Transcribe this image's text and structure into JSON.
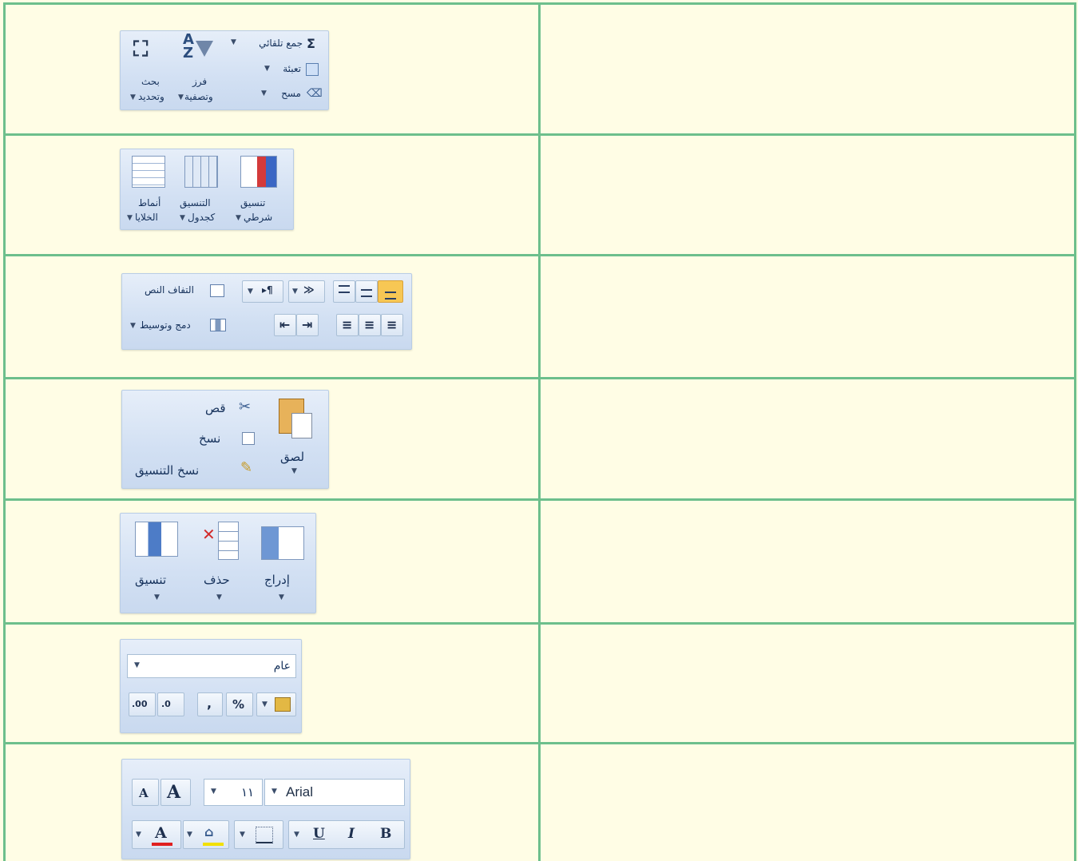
{
  "editing_group": {
    "autosum": "جمع تلقائي",
    "fill": "تعبئة",
    "clear": "مسح",
    "sort_filter": [
      "فرز",
      "وتصفية"
    ],
    "find_select": [
      "بحث",
      "وتحديد"
    ]
  },
  "styles_group": {
    "conditional_formatting": [
      "تنسيق",
      "شرطي"
    ],
    "format_as_table": [
      "التنسيق",
      "كجدول"
    ],
    "cell_styles": [
      "أنماط",
      "الخلايا"
    ]
  },
  "alignment_group": {
    "wrap_text": "التفاف النص",
    "merge_center": "دمج وتوسيط"
  },
  "clipboard_group": {
    "paste": "لصق",
    "cut": "قص",
    "copy": "نسخ",
    "format_painter": "نسخ التنسيق"
  },
  "cells_group": {
    "insert": "إدراج",
    "delete": "حذف",
    "format": "تنسيق"
  },
  "number_group": {
    "format_value": "عام",
    "percent": "%",
    "comma": ",",
    "inc_decimal": ".00",
    "dec_decimal": ".0"
  },
  "font_group": {
    "font_name": "Arial",
    "font_size": "١١",
    "grow_font": "A",
    "shrink_font": "A",
    "bold": "B",
    "italic": "I",
    "underline": "U",
    "font_color_letter": "A"
  },
  "colors": {
    "grid": "#6dbf8c",
    "cell_bg": "#fffde5",
    "ribbon_text": "#15315b",
    "font_color_bar": "#e02020",
    "fill_color_bar": "#f2e000"
  }
}
